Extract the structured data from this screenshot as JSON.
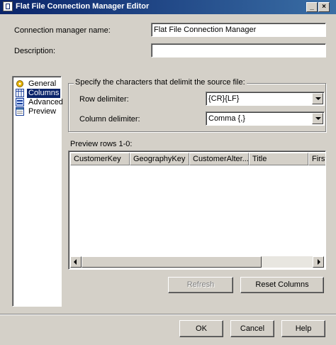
{
  "window": {
    "title": "Flat File Connection Manager Editor"
  },
  "connection": {
    "name_label": "Connection manager name:",
    "name_value": "Flat File Connection Manager",
    "description_label": "Description:",
    "description_value": ""
  },
  "sidebar": {
    "items": [
      {
        "label": "General",
        "icon": "general-icon"
      },
      {
        "label": "Columns",
        "icon": "columns-icon",
        "selected": true
      },
      {
        "label": "Advanced",
        "icon": "advanced-icon"
      },
      {
        "label": "Preview",
        "icon": "preview-icon"
      }
    ]
  },
  "delimiters": {
    "group_title": "Specify the characters that delimit the source file:",
    "row_label": "Row delimiter:",
    "row_value": "{CR}{LF}",
    "column_label": "Column delimiter:",
    "column_value": "Comma {,}"
  },
  "preview": {
    "label": "Preview rows 1-0:",
    "columns": [
      "CustomerKey",
      "GeographyKey",
      "CustomerAlter...",
      "Title",
      "FirstN"
    ]
  },
  "actions": {
    "refresh": "Refresh",
    "reset_columns": "Reset Columns"
  },
  "footer": {
    "ok": "OK",
    "cancel": "Cancel",
    "help": "Help"
  }
}
